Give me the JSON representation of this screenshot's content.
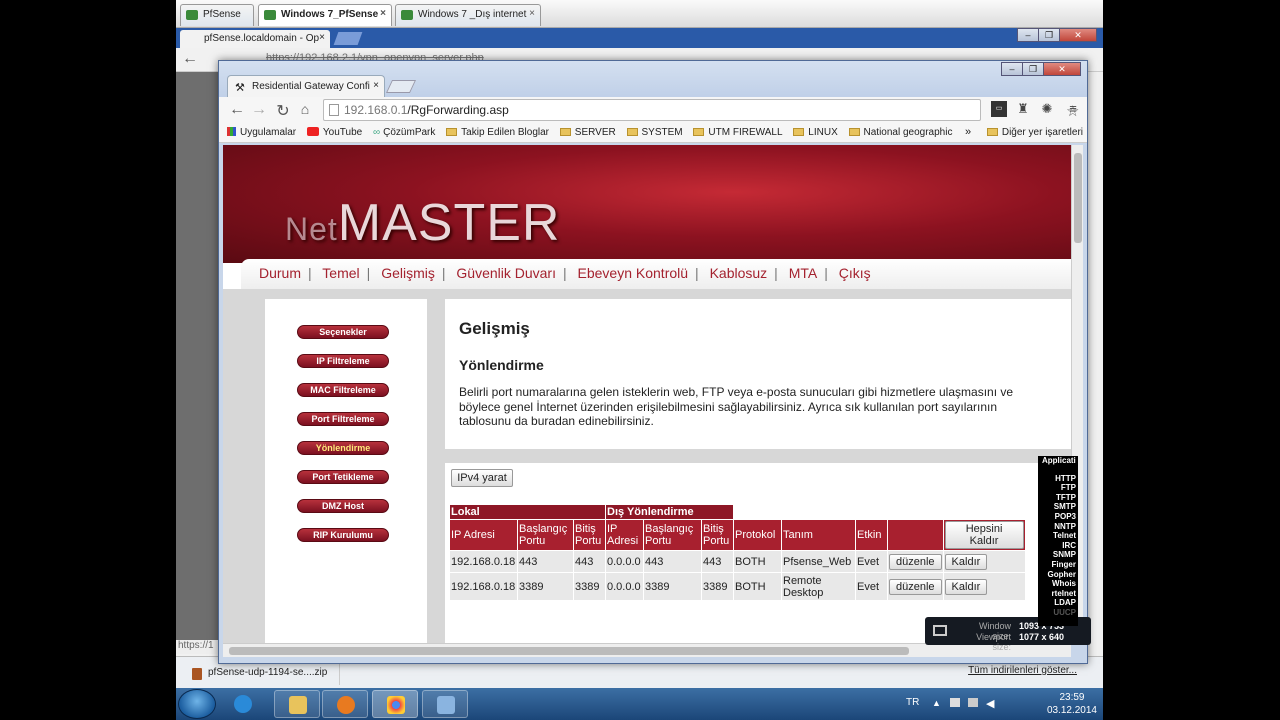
{
  "vm_tabs": [
    {
      "label": "PfSense"
    },
    {
      "label": "Windows 7_PfSense"
    },
    {
      "label": "Windows 7 _Dış internet"
    }
  ],
  "back_browser": {
    "tab_title": "pfSense.localdomain - Op",
    "url": "https://192.168.2.1/vpn_openvpn_server.php",
    "status_text": "https://1",
    "download": {
      "file": "pfSense-udp-1194-se....zip",
      "show_all": "Tüm indirilenleri göster..."
    }
  },
  "browser": {
    "tab_title": "Residential Gateway Confi",
    "url_host": "192.168.0.1",
    "url_path": "/RgForwarding.asp",
    "bookmarks": [
      "Uygulamalar",
      "YouTube",
      "ÇözümPark",
      "Takip Edilen Bloglar",
      "SERVER",
      "SYSTEM",
      "UTM FIREWALL",
      "LINUX",
      "National geographic"
    ],
    "other_bookmarks": "Diğer yer işaretleri",
    "more": "»"
  },
  "page": {
    "logo_net": "Net",
    "logo_master": "MASTER",
    "menu": [
      "Durum",
      "Temel",
      "Gelişmiş",
      "Güvenlik Duvarı",
      "Ebeveyn Kontrolü",
      "Kablosuz",
      "MTA",
      "Çıkış"
    ],
    "sidebar": [
      "Seçenekler",
      "IP Filtreleme",
      "MAC Filtreleme",
      "Port Filtreleme",
      "Yönlendirme",
      "Port Tetikleme",
      "DMZ Host",
      "RIP Kurulumu"
    ],
    "sidebar_selected": 4,
    "title": "Gelişmiş",
    "subtitle": "Yönlendirme",
    "description_line1": "Belirli port numaralarına gelen isteklerin web, FTP veya e-posta sunucuları gibi hizmetlere ulaşmasını ve",
    "description_line2": "böylece genel İnternet üzerinden erişilebilmesini sağlayabilirsiniz. Ayrıca sık kullanılan port sayılarının tablosunu da buradan edinebilirsiniz.",
    "create_button": "IPv4 yarat",
    "table": {
      "group_local": "Lokal",
      "group_external": "Dış Yönlendirme",
      "headers": [
        "IP Adresi",
        "Başlangıç Portu",
        "Bitiş Portu",
        "IP Adresi",
        "Başlangıç Portu",
        "Bitiş Portu",
        "Protokol",
        "Tanım",
        "Etkin"
      ],
      "remove_all": "Hepsini Kaldır",
      "edit_label": "düzenle",
      "remove_label": "Kaldır",
      "rows": [
        [
          "192.168.0.18",
          "443",
          "443",
          "0.0.0.0",
          "443",
          "443",
          "BOTH",
          "Pfsense_Web",
          "Evet"
        ],
        [
          "192.168.0.18",
          "3389",
          "3389",
          "0.0.0.0",
          "3389",
          "3389",
          "BOTH",
          "Remote Desktop",
          "Evet"
        ]
      ]
    }
  },
  "window_size": {
    "window_label": "Window size:",
    "window_value": "1093 x 753",
    "viewport_label": "Viewport size:",
    "viewport_value": "1077 x 640"
  },
  "applications": [
    "Applicati",
    "HTTP",
    "FTP",
    "TFTP",
    "SMTP",
    "POP3",
    "NNTP",
    "Telnet",
    "IRC",
    "SNMP",
    "Finger",
    "Gopher",
    "Whois",
    "rtelnet",
    "LDAP",
    "UUCP"
  ],
  "taskbar": {
    "lang": "TR",
    "time": "23:59",
    "date": "03.12.2014"
  }
}
